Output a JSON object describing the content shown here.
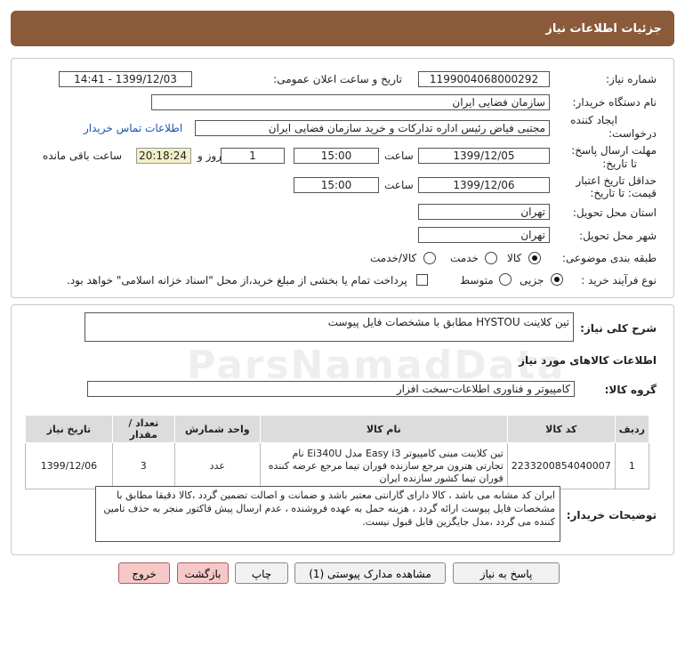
{
  "header": {
    "title": "جزئیات اطلاعات نیاز"
  },
  "details": {
    "need_number_label": "شماره نیاز:",
    "need_number": "1199004068000292",
    "announce_label": "تاریخ و ساعت اعلان عمومی:",
    "announce_value": "1399/12/03 - 14:41",
    "buyer_org_label": "نام دستگاه خریدار:",
    "buyer_org": "سازمان فضایی ایران",
    "creator_label_1": "ایجاد کننده",
    "creator_label_2": "درخواست:",
    "creator": "مجتبی  فیاض رئیس اداره تدارکات و خرید سازمان فضایی ایران",
    "contact_link": "اطلاعات تماس خریدار",
    "reply_deadline_label_1": "مهلت ارسال پاسخ:",
    "reply_deadline_label_2": "تا تاریخ:",
    "reply_date": "1399/12/05",
    "time_label": "ساعت",
    "reply_time": "15:00",
    "days_count": "1",
    "day_label": "روز و",
    "remaining_time": "20:18:24",
    "remaining_label": "ساعت باقی مانده",
    "validity_label_1": "حداقل تاریخ اعتبار",
    "validity_label_2": "قیمت: تا تاریخ:",
    "validity_date": "1399/12/06",
    "validity_time": "15:00",
    "province_label": "استان محل تحویل:",
    "province": "تهران",
    "city_label": "شهر محل تحویل:",
    "city": "تهران",
    "category_label": "طبقه بندی موضوعی:",
    "category_options": [
      "کالا",
      "خدمت",
      "کالا/خدمت"
    ],
    "process_label": "نوع فرآیند خرید :",
    "process_options": [
      "جزیی",
      "متوسط"
    ],
    "payment_note": "پرداخت تمام یا بخشی از مبلغ خرید،از محل \"اسناد خزانه اسلامی\" خواهد بود."
  },
  "need": {
    "summary_label": "شرح کلی نیاز:",
    "summary": "تین کلاینت HYSTOU مطابق با مشخصات فایل پیوست",
    "goods_info_title": "اطلاعات کالاهای مورد نیاز",
    "group_label": "گروه کالا:",
    "group": "کامپیوتر و فناوری اطلاعات-سخت افزار"
  },
  "table": {
    "headers": [
      "ردیف",
      "کد کالا",
      "نام کالا",
      "واحد شمارش",
      "تعداد / مقدار",
      "تاریخ نیاز"
    ],
    "rows": [
      {
        "row": "1",
        "code": "2233200854040007",
        "name": "تین کلاینت مینی کامپیوتر Easy i3 مدل Ei340U نام تجارتی هترون مرجع سازنده فوران تیما مرجع عرضه کننده فوران تیما کشور سازنده ایران",
        "unit": "عدد",
        "qty": "3",
        "date": "1399/12/06"
      }
    ]
  },
  "buyer_notes": {
    "label": "توضیحات خریدار:",
    "text": "ایران کد مشابه می باشد ، کالا دارای گارانتی معتبر باشد و ضمانت و اصالت تضمین گردد ،کالا دقیقا مطابق با مشخصات فایل پیوست ارائه گردد ، هزینه حمل به عهده فروشنده ، عدم ارسال پیش فاکتور منجر به حذف تامین کننده می گردد ،مدل جایگزین قابل قبول نیست."
  },
  "buttons": {
    "reply": "پاسخ به نیاز",
    "attachments": "مشاهده مدارک پیوستی (1)",
    "print": "چاپ",
    "back": "بازگشت",
    "exit": "خروج"
  },
  "watermark": "ParsNamadData",
  "colors": {
    "header_bg": "#8a5a3b",
    "remaining_bg": "#f2efc9",
    "link": "#1a55b3",
    "red_button": "#f6c8c8"
  }
}
